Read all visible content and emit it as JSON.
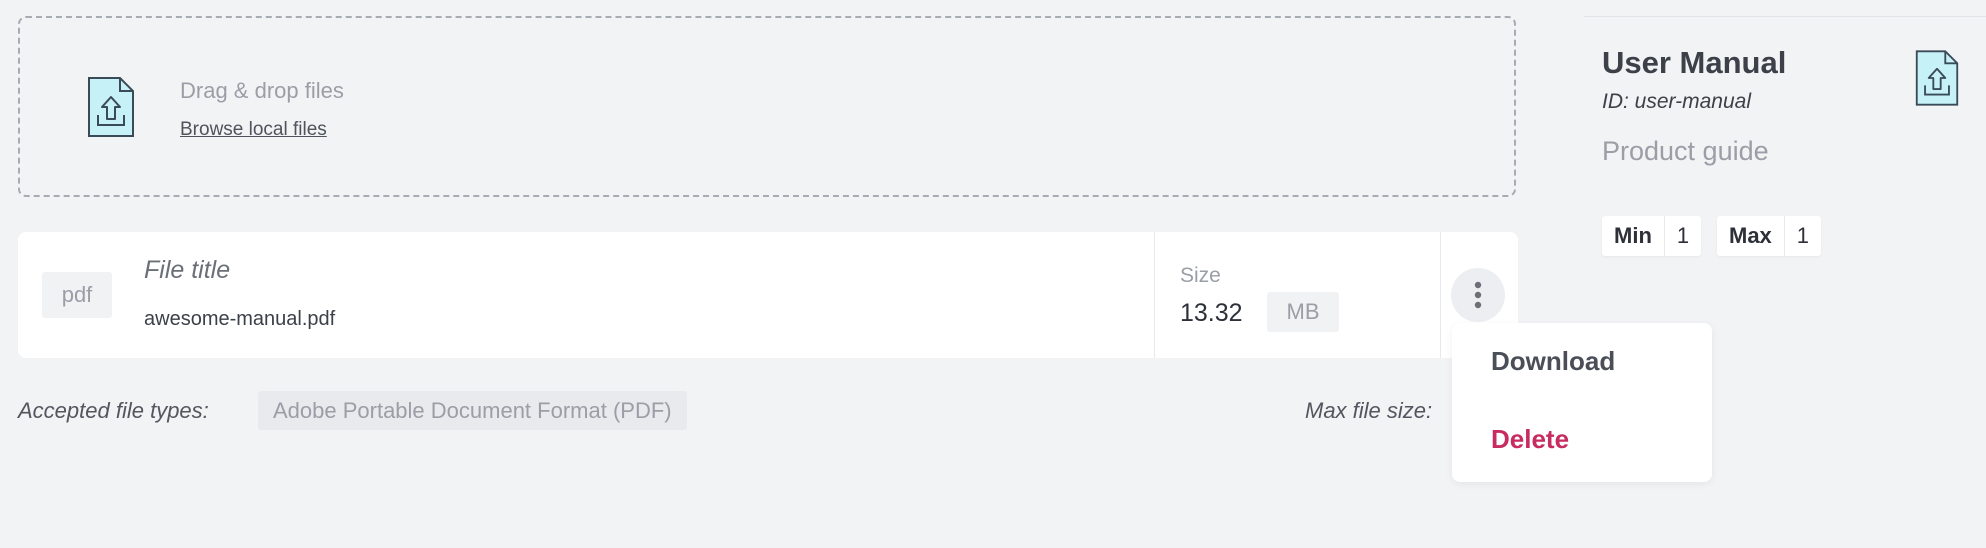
{
  "dropzone": {
    "title": "Drag & drop files",
    "browse_label": "Browse local files",
    "icon": "file-upload-icon"
  },
  "file": {
    "extension": "pdf",
    "title_placeholder": "File title",
    "filename": "awesome-manual.pdf",
    "size_label": "Size",
    "size_value": "13.32",
    "size_unit": "MB"
  },
  "accepted": {
    "label": "Accepted file types:",
    "types": [
      "Adobe Portable Document Format (PDF)"
    ]
  },
  "max_size": {
    "label": "Max file size:"
  },
  "menu": {
    "items": [
      {
        "label": "Download",
        "color": "#4a4e57"
      },
      {
        "label": "Delete",
        "color": "#c72b5f"
      }
    ]
  },
  "side": {
    "title": "User Manual",
    "id_text": "ID: user-manual",
    "description": "Product guide",
    "icon": "file-upload-icon",
    "min_label": "Min",
    "min_value": "1",
    "max_label": "Max",
    "max_value": "1"
  },
  "colors": {
    "background": "#f2f3f5",
    "accent_delete": "#c72b5f",
    "icon_fill": "#c6f1f6",
    "icon_stroke": "#3a4a56"
  }
}
